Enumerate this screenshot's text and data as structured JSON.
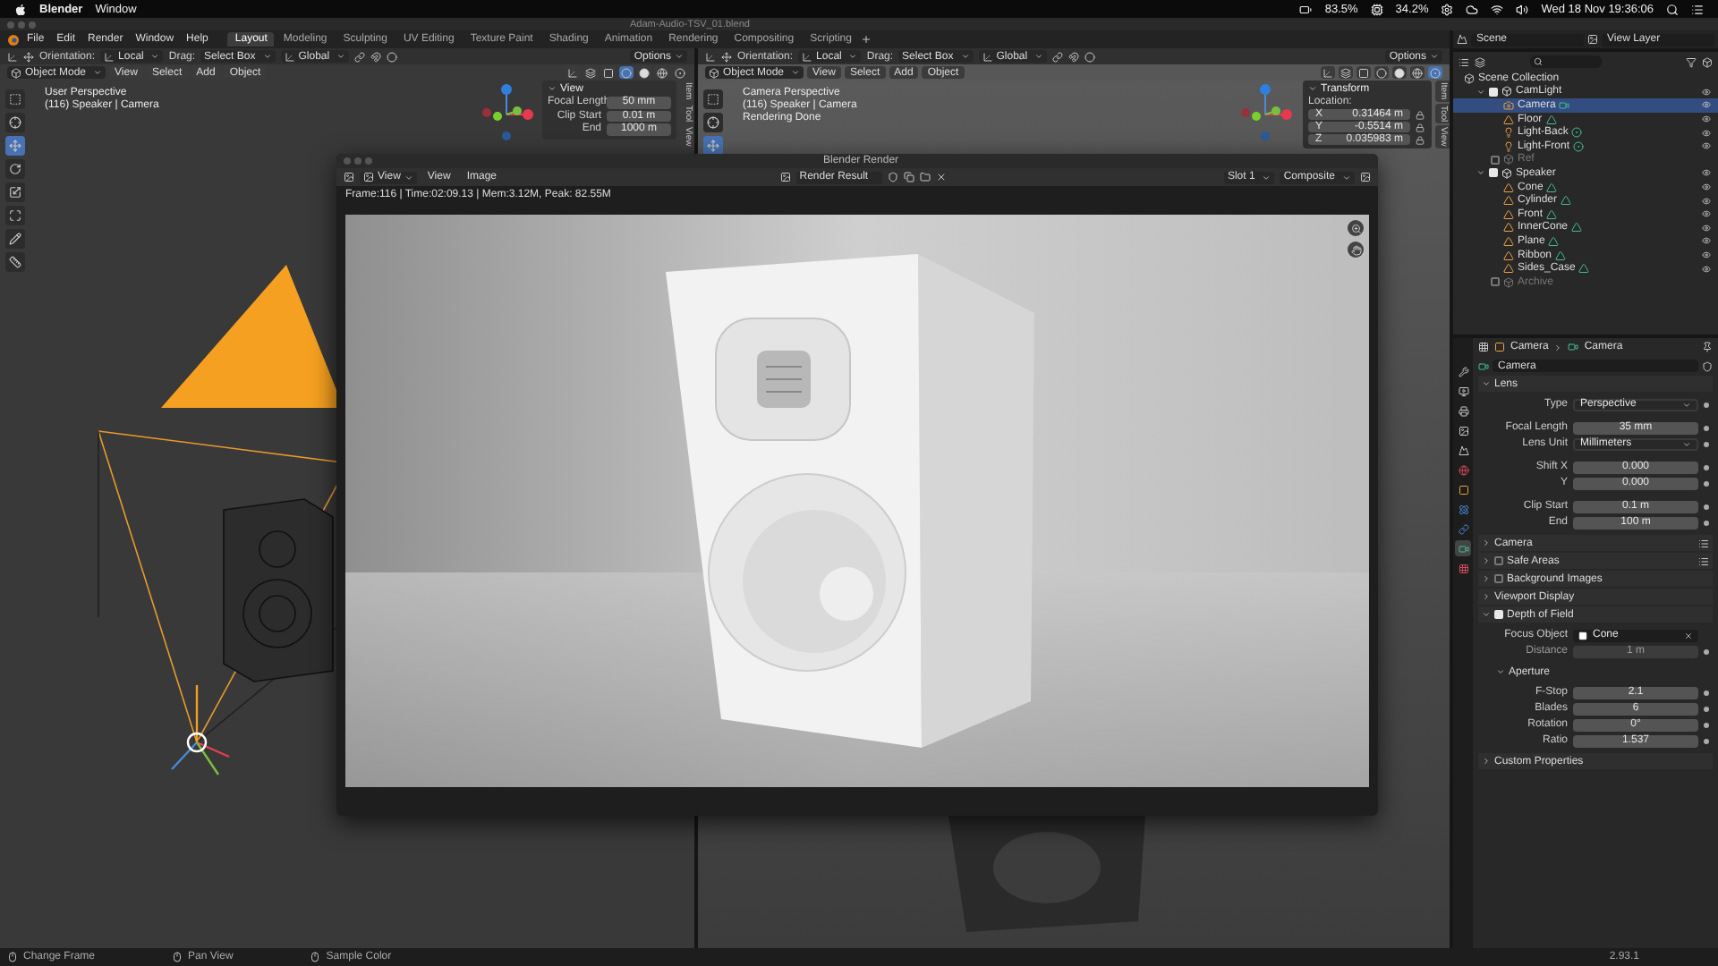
{
  "menubar": {
    "app": "Blender",
    "menus": [
      "Window"
    ],
    "battery": "83.5%",
    "cpu": "34.2%",
    "clock": "Wed 18 Nov  19:36:06"
  },
  "window": {
    "title": "Adam-Audio-TSV_01.blend"
  },
  "topbar": {
    "menus": [
      "File",
      "Edit",
      "Render",
      "Window",
      "Help"
    ],
    "workspaces": [
      {
        "label": "Layout",
        "selected": true
      },
      {
        "label": "Modeling",
        "selected": false
      },
      {
        "label": "Sculpting",
        "selected": false
      },
      {
        "label": "UV Editing",
        "selected": false
      },
      {
        "label": "Texture Paint",
        "selected": false
      },
      {
        "label": "Shading",
        "selected": false
      },
      {
        "label": "Animation",
        "selected": false
      },
      {
        "label": "Rendering",
        "selected": false
      },
      {
        "label": "Compositing",
        "selected": false
      },
      {
        "label": "Scripting",
        "selected": false
      }
    ]
  },
  "viewports": [
    {
      "kind": "perspective",
      "tool_settings": {
        "orientation_label": "Orientation:",
        "orientation": "Local",
        "drag_label": "Drag:",
        "drag": "Select Box",
        "transform": "Global",
        "options": "Options"
      },
      "mode": "Object Mode",
      "menus": [
        "View",
        "Select",
        "Add",
        "Object"
      ],
      "shading": [
        {
          "selected": true
        },
        {
          "selected": false
        },
        {
          "selected": false
        },
        {
          "selected": false
        }
      ],
      "overlay_text": [
        "User Perspective",
        "(116) Speaker | Camera"
      ],
      "tools": [
        {
          "selected": false
        },
        {
          "selected": false
        },
        {
          "selected": true
        },
        {
          "selected": false
        },
        {
          "selected": false
        },
        {
          "selected": false
        },
        {
          "selected": false
        },
        {
          "selected": false
        }
      ],
      "panel": {
        "title": "View",
        "rows": [
          {
            "kind": "labeled",
            "label": "Focal Length",
            "value": "50 mm"
          },
          {
            "kind": "labeled",
            "label": "Clip Start",
            "value": "0.01 m"
          },
          {
            "kind": "labeled",
            "label": "End",
            "value": "1000 m"
          }
        ]
      },
      "sidebar_tabs": [
        "Item",
        "Tool",
        "View"
      ]
    },
    {
      "kind": "camera",
      "tool_settings": {
        "orientation_label": "Orientation:",
        "orientation": "Local",
        "drag_label": "Drag:",
        "drag": "Select Box",
        "transform": "Global",
        "options": "Options"
      },
      "mode": "Object Mode",
      "menus": [
        "View",
        "Select",
        "Add",
        "Object"
      ],
      "shading": [
        {
          "selected": false
        },
        {
          "selected": false
        },
        {
          "selected": false
        },
        {
          "selected": true
        }
      ],
      "overlay_text": [
        "Camera Perspective",
        "(116) Speaker | Camera",
        "Rendering Done"
      ],
      "tools": [
        {
          "selected": false
        },
        {
          "selected": false
        },
        {
          "selected": true
        }
      ],
      "panel": {
        "title": "Transform",
        "subtitle": "Location:",
        "rows": [
          {
            "kind": "axis",
            "label": "X",
            "value": "0.31464 m"
          },
          {
            "kind": "axis",
            "label": "Y",
            "value": "-0.5514 m"
          },
          {
            "kind": "axis",
            "label": "Z",
            "value": "0.035983 m"
          }
        ]
      },
      "sidebar_tabs": [
        "Item",
        "Tool",
        "View"
      ]
    }
  ],
  "render_window": {
    "title": "Blender Render",
    "menus": [
      "View",
      "View",
      "Image"
    ],
    "image": "Render Result",
    "slot": "Slot 1",
    "layer": "Composite",
    "info": "Frame:116 | Time:02:09.13 | Mem:3.12M, Peak: 82.55M"
  },
  "scene_selector": {
    "scene": "Scene",
    "view_layer": "View Layer"
  },
  "outliner": {
    "root": "Scene Collection",
    "tree": [
      {
        "name": "CamLight",
        "kind": "collection",
        "checked": true,
        "expanded": true,
        "selected": false,
        "children": [
          {
            "name": "Camera",
            "kind": "camera",
            "selected": true
          },
          {
            "name": "Floor",
            "kind": "mesh",
            "selected": false
          },
          {
            "name": "Light-Back",
            "kind": "light",
            "selected": false
          },
          {
            "name": "Light-Front",
            "kind": "light",
            "selected": false
          }
        ]
      },
      {
        "name": "Ref",
        "kind": "collection",
        "checked": false,
        "selected": false
      },
      {
        "name": "Speaker",
        "kind": "collection",
        "checked": true,
        "expanded": true,
        "selected": false,
        "children": [
          {
            "name": "Cone",
            "kind": "mesh",
            "selected": false
          },
          {
            "name": "Cylinder",
            "kind": "mesh",
            "selected": false
          },
          {
            "name": "Front",
            "kind": "mesh",
            "selected": false
          },
          {
            "name": "InnerCone",
            "kind": "mesh",
            "selected": false
          },
          {
            "name": "Plane",
            "kind": "mesh",
            "selected": false
          },
          {
            "name": "Ribbon",
            "kind": "mesh",
            "selected": false
          },
          {
            "name": "Sides_Case",
            "kind": "mesh",
            "selected": false
          }
        ]
      },
      {
        "name": "Archive",
        "kind": "collection",
        "checked": false,
        "selected": false
      }
    ]
  },
  "properties": {
    "tabs": [
      {
        "selected": false
      },
      {
        "selected": false
      },
      {
        "selected": false
      },
      {
        "selected": false
      },
      {
        "selected": false
      },
      {
        "selected": false
      },
      {
        "selected": false
      },
      {
        "selected": false
      },
      {
        "selected": false
      },
      {
        "selected": true
      },
      {
        "selected": false
      }
    ],
    "breadcrumb": [
      "Camera",
      "Camera"
    ],
    "datablock": "Camera",
    "sections": [
      {
        "title": "Lens",
        "expanded": true,
        "groups": [
          [
            {
              "kind": "dropdown",
              "label": "Type",
              "value": "Perspective"
            }
          ],
          [
            {
              "kind": "number",
              "label": "Focal Length",
              "value": "35 mm"
            },
            {
              "kind": "dropdown",
              "label": "Lens Unit",
              "value": "Millimeters"
            }
          ],
          [
            {
              "kind": "number",
              "label": "Shift X",
              "value": "0.000"
            },
            {
              "kind": "number",
              "label": "Y",
              "value": "0.000"
            }
          ],
          [
            {
              "kind": "number",
              "label": "Clip Start",
              "value": "0.1 m"
            },
            {
              "kind": "number",
              "label": "End",
              "value": "100 m"
            }
          ]
        ]
      },
      {
        "title": "Camera",
        "expanded": false,
        "presets": true
      },
      {
        "title": "Safe Areas",
        "expanded": false,
        "checked": false,
        "presets": true
      },
      {
        "title": "Background Images",
        "expanded": false,
        "checked": false
      },
      {
        "title": "Viewport Display",
        "expanded": false
      },
      {
        "title": "Depth of Field",
        "expanded": true,
        "checked": true,
        "groups": [
          [
            {
              "kind": "object",
              "label": "Focus Object",
              "value": "Cone"
            },
            {
              "kind": "number",
              "label": "Distance",
              "value": "1 m",
              "disabled": true
            }
          ]
        ],
        "subpanels": [
          {
            "title": "Aperture",
            "expanded": true,
            "groups": [
              [
                {
                  "kind": "number",
                  "label": "F-Stop",
                  "value": "2.1"
                },
                {
                  "kind": "number",
                  "label": "Blades",
                  "value": "6"
                },
                {
                  "kind": "number",
                  "label": "Rotation",
                  "value": "0°"
                },
                {
                  "kind": "number",
                  "label": "Ratio",
                  "value": "1.537"
                }
              ]
            ]
          }
        ]
      },
      {
        "title": "Custom Properties",
        "expanded": false
      }
    ]
  },
  "status_bar": {
    "items": [
      "Change Frame",
      "Pan View",
      "Sample Color"
    ],
    "version": "2.93.1"
  }
}
